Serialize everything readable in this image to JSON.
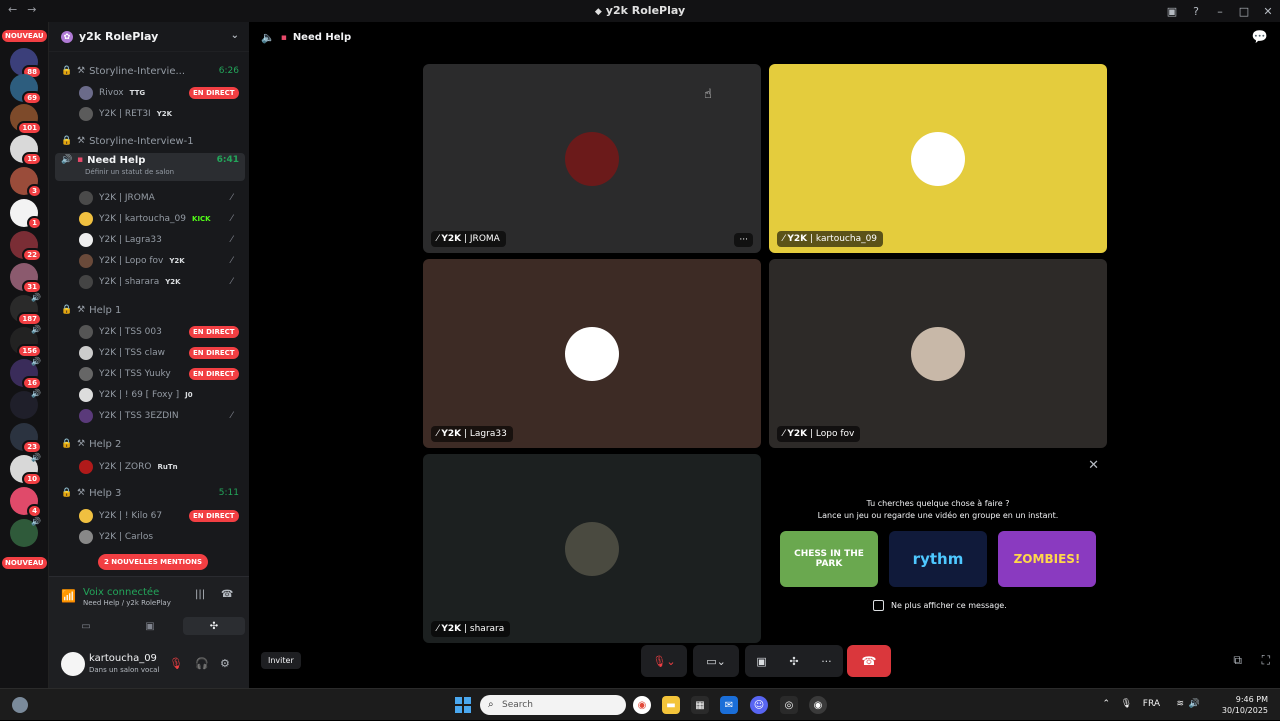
{
  "window": {
    "title": "y2k RolePlay"
  },
  "rail": {
    "new_label": "NOUVEAU",
    "badges": [
      "88",
      "69",
      "101",
      "15",
      "3",
      "1",
      "22",
      "31",
      "187",
      "156",
      "16",
      "23",
      "10",
      "4"
    ],
    "bottom_new_label": "NOUVEAU"
  },
  "server": {
    "name": "y2k RolePlay"
  },
  "channels": [
    {
      "name": "Storyline-Intervie...",
      "time": "6:26"
    },
    {
      "name": "Storyline-Interview-1"
    },
    {
      "name": "Need Help",
      "time": "6:41",
      "status": "Définir un statut de salon"
    },
    {
      "name": "Help 1"
    },
    {
      "name": "Help 2"
    },
    {
      "name": "Help 3",
      "time": "5:11"
    }
  ],
  "voice_users": {
    "story": [
      {
        "name": "Rivox",
        "tag": "TTG",
        "live": "EN DIRECT"
      },
      {
        "name": "Y2K | RET3I",
        "tag": "Y2K"
      }
    ],
    "needhelp": [
      {
        "name": "Y2K | JROMA"
      },
      {
        "name": "Y2K | kartoucha_09",
        "tag": "KICK"
      },
      {
        "name": "Y2K | Lagra33"
      },
      {
        "name": "Y2K | Lopo fov",
        "tag": "Y2K"
      },
      {
        "name": "Y2K | sharara",
        "tag": "Y2K"
      }
    ],
    "help1": [
      {
        "name": "Y2K | TSS 003",
        "live": "EN DIRECT"
      },
      {
        "name": "Y2K | TSS claw",
        "live": "EN DIRECT"
      },
      {
        "name": "Y2K | TSS Yuuky",
        "live": "EN DIRECT"
      },
      {
        "name": "Y2K | ! 69 [ Foxy ]",
        "tag": "J0"
      },
      {
        "name": "Y2K | TSS 3EZDIN"
      }
    ],
    "help2": [
      {
        "name": "Y2K | ZORO",
        "tag": "RuTn"
      }
    ],
    "help3": [
      {
        "name": "Y2K | ! Kilo 67",
        "live": "EN DIRECT"
      },
      {
        "name": "Y2K | Carlos"
      }
    ]
  },
  "mentions": "2 NOUVELLES MENTIONS",
  "voice_panel": {
    "status": "Voix connectée",
    "location": "Need Help / y2k RolePlay"
  },
  "user": {
    "name": "kartoucha_09",
    "status": "Dans un salon vocal"
  },
  "main": {
    "channel": "Need Help",
    "tiles": [
      {
        "tag": "Y2K",
        "name": "JROMA"
      },
      {
        "tag": "Y2K",
        "name": "kartoucha_09"
      },
      {
        "tag": "Y2K",
        "name": "Lagra33"
      },
      {
        "tag": "Y2K",
        "name": "Lopo fov"
      },
      {
        "tag": "Y2K",
        "name": "sharara"
      }
    ],
    "activity": {
      "line1": "Tu cherches quelque chose à faire ?",
      "line2": "Lance un jeu ou regarde une vidéo en groupe en un instant.",
      "cards": [
        "CHESS IN THE PARK",
        "rythm",
        "ZOMBIES!"
      ],
      "checkbox": "Ne plus afficher ce message."
    },
    "invite": "Inviter"
  },
  "taskbar": {
    "search": "Search",
    "lang": "FRA",
    "time": "9:46 PM",
    "date": "30/10/2025"
  },
  "colors": {
    "accent": "#5865f2",
    "live": "#f23f43",
    "connected": "#23a55a",
    "hangup": "#da373c",
    "yellow_tile": "#e4cc3d"
  }
}
